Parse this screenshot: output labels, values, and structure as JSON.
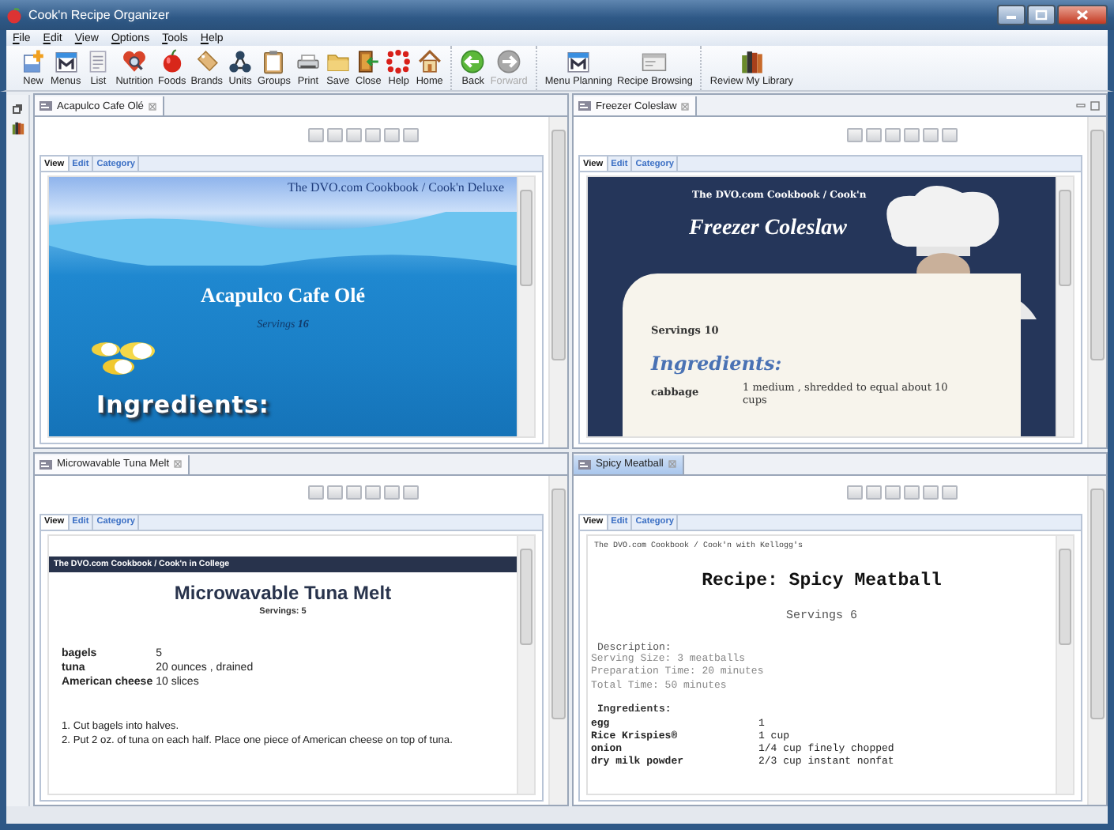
{
  "window": {
    "title": "Cook'n Recipe Organizer"
  },
  "menu": [
    "File",
    "Edit",
    "View",
    "Options",
    "Tools",
    "Help"
  ],
  "toolbar": {
    "groups": [
      {
        "buttons": [
          {
            "label": "New",
            "disabled": false
          },
          {
            "label": "Menus",
            "disabled": false
          },
          {
            "label": "List",
            "disabled": false
          },
          {
            "label": "Nutrition",
            "disabled": false
          },
          {
            "label": "Foods",
            "disabled": false
          },
          {
            "label": "Brands",
            "disabled": false
          },
          {
            "label": "Units",
            "disabled": false
          },
          {
            "label": "Groups",
            "disabled": false
          },
          {
            "label": "Print",
            "disabled": false
          },
          {
            "label": "Save",
            "disabled": false
          },
          {
            "label": "Close",
            "disabled": false
          },
          {
            "label": "Help",
            "disabled": false
          },
          {
            "label": "Home",
            "disabled": false
          }
        ]
      },
      {
        "buttons": [
          {
            "label": "Back",
            "disabled": false
          },
          {
            "label": "Forward",
            "disabled": true
          }
        ]
      },
      {
        "buttons": [
          {
            "label": "Menu Planning",
            "disabled": false
          },
          {
            "label": "Recipe Browsing",
            "disabled": false
          }
        ]
      },
      {
        "buttons": [
          {
            "label": "Review My Library",
            "disabled": false
          }
        ]
      }
    ]
  },
  "panes": [
    {
      "tab": {
        "label": "Acapulco Cafe Olé",
        "selected": false
      },
      "window_controls": false,
      "view_tabs": [
        {
          "label": "View",
          "selected": true
        },
        {
          "label": "Edit",
          "selected": false
        },
        {
          "label": "Category",
          "selected": false
        }
      ],
      "recipe": {
        "kind": "ocean",
        "source": "The DVO.com Cookbook / Cook'n Deluxe",
        "title": "Acapulco Cafe Olé",
        "servings": "Servings **16**",
        "ingredients_heading": "Ingredients:"
      }
    },
    {
      "tab": {
        "label": "Freezer Coleslaw",
        "selected": false
      },
      "window_controls": true,
      "view_tabs": [
        {
          "label": "View",
          "selected": true
        },
        {
          "label": "Edit",
          "selected": false
        },
        {
          "label": "Category",
          "selected": false
        }
      ],
      "recipe": {
        "kind": "chef",
        "source": "The DVO.com Cookbook / Cook'n",
        "title": "Freezer Coleslaw",
        "servings": "Servings 10",
        "ingredients_heading": "Ingredients:",
        "ingredients": [
          {
            "name": "cabbage",
            "amount": "1 medium , shredded to equal about 10 cups"
          }
        ]
      }
    },
    {
      "tab": {
        "label": "Microwavable Tuna Melt",
        "selected": false
      },
      "window_controls": false,
      "view_tabs": [
        {
          "label": "View",
          "selected": true
        },
        {
          "label": "Edit",
          "selected": false
        },
        {
          "label": "Category",
          "selected": false
        }
      ],
      "recipe": {
        "kind": "sans",
        "source": "The DVO.com Cookbook / Cook'n in College",
        "title": "Microwavable Tuna Melt",
        "servings": "Servings: 5",
        "ingredients": [
          {
            "name": "bagels",
            "amount": "5"
          },
          {
            "name": "tuna",
            "amount": "20 ounces , drained"
          },
          {
            "name": "American cheese",
            "amount": "10 slices"
          }
        ],
        "directions": [
          "1. Cut bagels into halves.",
          "2. Put 2 oz. of tuna on each half. Place one piece of American cheese on top of tuna."
        ]
      }
    },
    {
      "tab": {
        "label": "Spicy Meatball",
        "selected": true
      },
      "window_controls": false,
      "view_tabs": [
        {
          "label": "View",
          "selected": true
        },
        {
          "label": "Edit",
          "selected": false
        },
        {
          "label": "Category",
          "selected": false
        }
      ],
      "recipe": {
        "kind": "mono",
        "source": "The DVO.com Cookbook / Cook'n with Kellogg's",
        "title": "Recipe: Spicy Meatball",
        "servings": "Servings 6",
        "description_heading": "Description:",
        "description": [
          "Serving Size: 3 meatballs",
          "Preparation Time: 20 minutes",
          "Total Time: 50 minutes"
        ],
        "ingredients_heading": "Ingredients:",
        "ingredients": [
          {
            "name": "egg",
            "amount": "1"
          },
          {
            "name": "Rice Krispies®",
            "amount": "1 cup"
          },
          {
            "name": "onion",
            "amount": "1/4 cup finely chopped"
          },
          {
            "name": "dry milk powder",
            "amount": "2/3 cup instant nonfat"
          }
        ]
      }
    }
  ]
}
